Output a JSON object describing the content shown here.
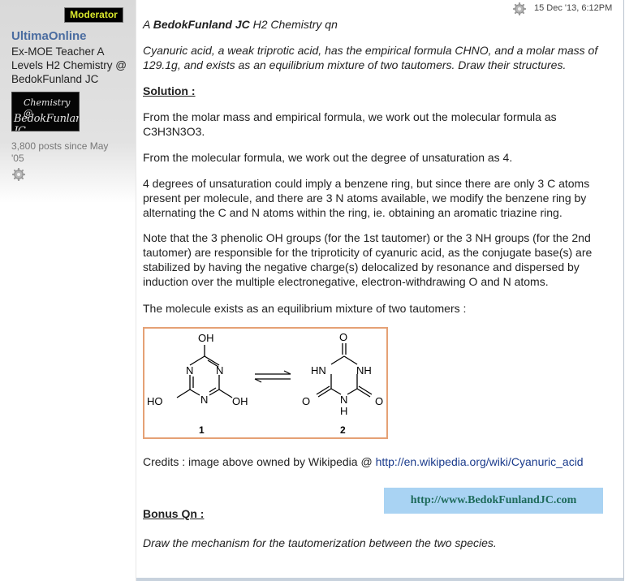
{
  "user": {
    "badge": "Moderator",
    "name": "UltimaOnline",
    "title": "Ex-MOE Teacher A Levels H2 Chemistry @ BedokFunland JC",
    "avatar_line1": "Chemistry @",
    "avatar_line2": "BedokFunland JC",
    "posts": "3,800 posts since May '05"
  },
  "post": {
    "date": "15 Dec '13, 6:12PM",
    "heading_prefix": "A ",
    "heading_brand": "BedokFunland JC",
    "heading_suffix": " H2 Chemistry qn",
    "question": "Cyanuric acid, a weak triprotic acid, has the empirical formula CHNO, and a molar mass of 129.1g, and exists as an equilibrium mixture of two tautomers. Draw their structures.",
    "solution_label": "Solution :",
    "para1": "From the molar mass and empirical formula, we work out the molecular formula as C3H3N3O3.",
    "para2": "From the molecular formula, we work out the degree of unsaturation as 4.",
    "para3": "4 degrees of unsaturation could imply a benzene ring, but since there are only 3 C atoms present per molecule, and there are 3 N atoms available, we modify the benzene ring by alternating the C and N atoms within the ring, ie. obtaining an aromatic triazine ring.",
    "para4": "Note that the 3 phenolic OH groups (for the 1st tautomer) or the 3 NH groups (for the 2nd tautomer) are responsible for the triproticity of cyanuric acid, as the conjugate base(s) are stabilized by having the negative charge(s) delocalized by resonance and dispersed by induction over the multiple electronegative, electron-withdrawing O and N atoms.",
    "para5": "The molecule exists as an equilibrium mixture of two tautomers :",
    "credits_prefix": "Credits : image above owned by Wikipedia @ ",
    "credits_link": "http://en.wikipedia.org/wiki/Cyanuric_acid",
    "banner": "http://www.BedokFunlandJC.com",
    "bonus_label": "Bonus Qn :",
    "bonus_question": "Draw the mechanism for the tautomerization between the two species."
  },
  "figure": {
    "label1": "1",
    "label2": "2",
    "oh": "OH",
    "ho": "HO",
    "n": "N",
    "hn": "HN",
    "nh": "NH",
    "h": "H",
    "o": "O"
  },
  "colors": {
    "badge_text": "#d8e62c",
    "username": "#4a6ca0",
    "link": "#1a3b8c",
    "banner_bg": "#a9d3f3",
    "figure_border": "#e5a175"
  }
}
